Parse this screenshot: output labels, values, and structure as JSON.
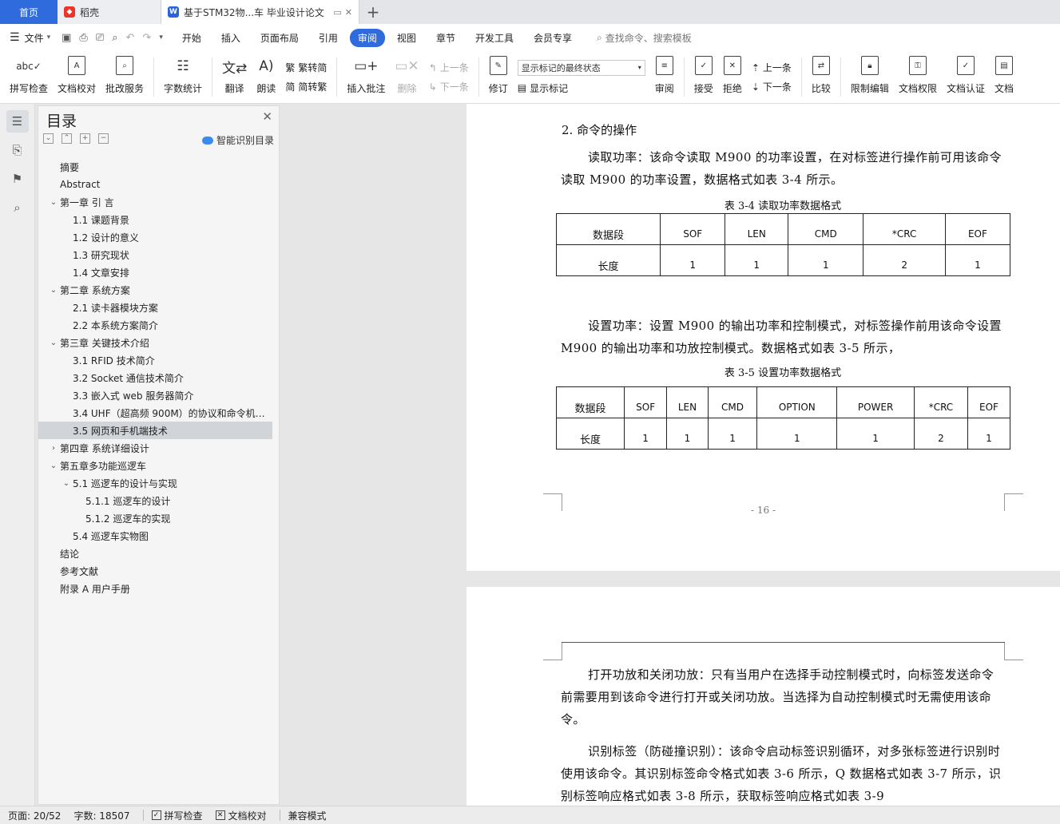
{
  "tabs": {
    "home": "首页",
    "items": [
      {
        "label": "稻壳",
        "icon": "daoke-logo-icon"
      },
      {
        "label": "基于STM32物...车 毕业设计论文",
        "icon": "wps-writer-icon"
      }
    ],
    "add": "+"
  },
  "menu": {
    "file": "文件",
    "items": [
      "开始",
      "插入",
      "页面布局",
      "引用",
      "审阅",
      "视图",
      "章节",
      "开发工具",
      "会员专享"
    ],
    "active": "审阅",
    "search": "查找命令、搜索模板"
  },
  "ribbon": {
    "spell": "拼写检查",
    "doccheck": "文档校对",
    "review_service": "批改服务",
    "wordcount": "字数统计",
    "translate": "翻译",
    "read": "朗读",
    "t2s": "繁转简",
    "s2t": "简转繁",
    "insert_comment": "插入批注",
    "delete": "删除",
    "prev_comment": "上一条",
    "next_comment": "下一条",
    "revise": "修订",
    "markup_select": "显示标记的最终状态",
    "show_markup": "显示标记",
    "review": "审阅",
    "accept": "接受",
    "reject": "拒绝",
    "prev": "上一条",
    "next": "下一条",
    "compare": "比较",
    "restrict": "限制编辑",
    "permission": "文档权限",
    "certify": "文档认证",
    "more": "文档"
  },
  "toc": {
    "title": "目录",
    "smart": "智能识别目录",
    "items": [
      {
        "text": "摘要",
        "level": 0,
        "arrow": ""
      },
      {
        "text": "Abstract",
        "level": 0,
        "arrow": ""
      },
      {
        "text": "第一章 引 言",
        "level": 0,
        "arrow": "v"
      },
      {
        "text": "1.1 课题背景",
        "level": 1,
        "arrow": ""
      },
      {
        "text": "1.2 设计的意义",
        "level": 1,
        "arrow": ""
      },
      {
        "text": "1.3 研究现状",
        "level": 1,
        "arrow": ""
      },
      {
        "text": "1.4 文章安排",
        "level": 1,
        "arrow": ""
      },
      {
        "text": "第二章  系统方案",
        "level": 0,
        "arrow": "v"
      },
      {
        "text": "2.1  读卡器模块方案",
        "level": 1,
        "arrow": ""
      },
      {
        "text": "2.2  本系统方案简介",
        "level": 1,
        "arrow": ""
      },
      {
        "text": "第三章  关键技术介绍",
        "level": 0,
        "arrow": "v"
      },
      {
        "text": "3.1 RFID 技术简介",
        "level": 1,
        "arrow": ""
      },
      {
        "text": "3.2 Socket 通信技术简介",
        "level": 1,
        "arrow": ""
      },
      {
        "text": "3.3  嵌入式 web 服务器简介",
        "level": 1,
        "arrow": ""
      },
      {
        "text": "3.4 UHF（超高频 900M）的协议和命令机…",
        "level": 1,
        "arrow": ""
      },
      {
        "text": "3.5  网页和手机端技术",
        "level": 1,
        "arrow": "",
        "selected": true
      },
      {
        "text": "第四章  系统详细设计",
        "level": 0,
        "arrow": ">"
      },
      {
        "text": "第五章多功能巡逻车",
        "level": 0,
        "arrow": "v"
      },
      {
        "text": "5.1  巡逻车的设计与实现",
        "level": 1,
        "arrow": "v"
      },
      {
        "text": "5.1.1  巡逻车的设计",
        "level": 2,
        "arrow": ""
      },
      {
        "text": "5.1.2  巡逻车的实现",
        "level": 2,
        "arrow": ""
      },
      {
        "text": "5.4  巡逻车实物图",
        "level": 1,
        "arrow": ""
      },
      {
        "text": "结论",
        "level": 0,
        "arrow": ""
      },
      {
        "text": "参考文献",
        "level": 0,
        "arrow": ""
      },
      {
        "text": "附录 A  用户手册",
        "level": 0,
        "arrow": ""
      }
    ]
  },
  "doc": {
    "heading": "2. 命令的操作",
    "para1": "读取功率：该命令读取 M900 的功率设置，在对标签进行操作前可用该命令读取 M900 的功率设置，数据格式如表 3-4 所示。",
    "table1": {
      "caption": "表 3-4  读取功率数据格式",
      "header": [
        "数据段",
        "SOF",
        "LEN",
        "CMD",
        "*CRC",
        "EOF"
      ],
      "row": [
        "长度",
        "1",
        "1",
        "1",
        "2",
        "1"
      ]
    },
    "para2": "设置功率：设置 M900 的输出功率和控制模式，对标签操作前用该命令设置 M900 的输出功率和功放控制模式。数据格式如表 3-5 所示，",
    "table2": {
      "caption": "表 3-5 设置功率数据格式",
      "header": [
        "数据段",
        "SOF",
        "LEN",
        "CMD",
        "OPTION",
        "POWER",
        "*CRC",
        "EOF"
      ],
      "row": [
        "长度",
        "1",
        "1",
        "1",
        "1",
        "1",
        "2",
        "1"
      ]
    },
    "page_number": "- 16 -",
    "para3": "打开功放和关闭功放：只有当用户在选择手动控制模式时，向标签发送命令前需要用到该命令进行打开或关闭功放。当选择为自动控制模式时无需使用该命令。",
    "para4": "识别标签（防碰撞识别）：该命令启动标签识别循环，对多张标签进行识别时使用该命令。其识别标签命令格式如表 3-6 所示，Q 数据格式如表 3-7 所示，识别标签响应格式如表 3-8 所示，获取标签响应格式如表 3-9"
  },
  "status": {
    "page": "页面: 20/52",
    "words": "字数: 18507",
    "spell": "拼写检查",
    "doccheck": "文档校对",
    "compat": "兼容模式"
  },
  "colors": {
    "accent": "#2f6bdc",
    "selected_toc": "#d1d4d9",
    "page_bg": "#e6e6e6"
  }
}
